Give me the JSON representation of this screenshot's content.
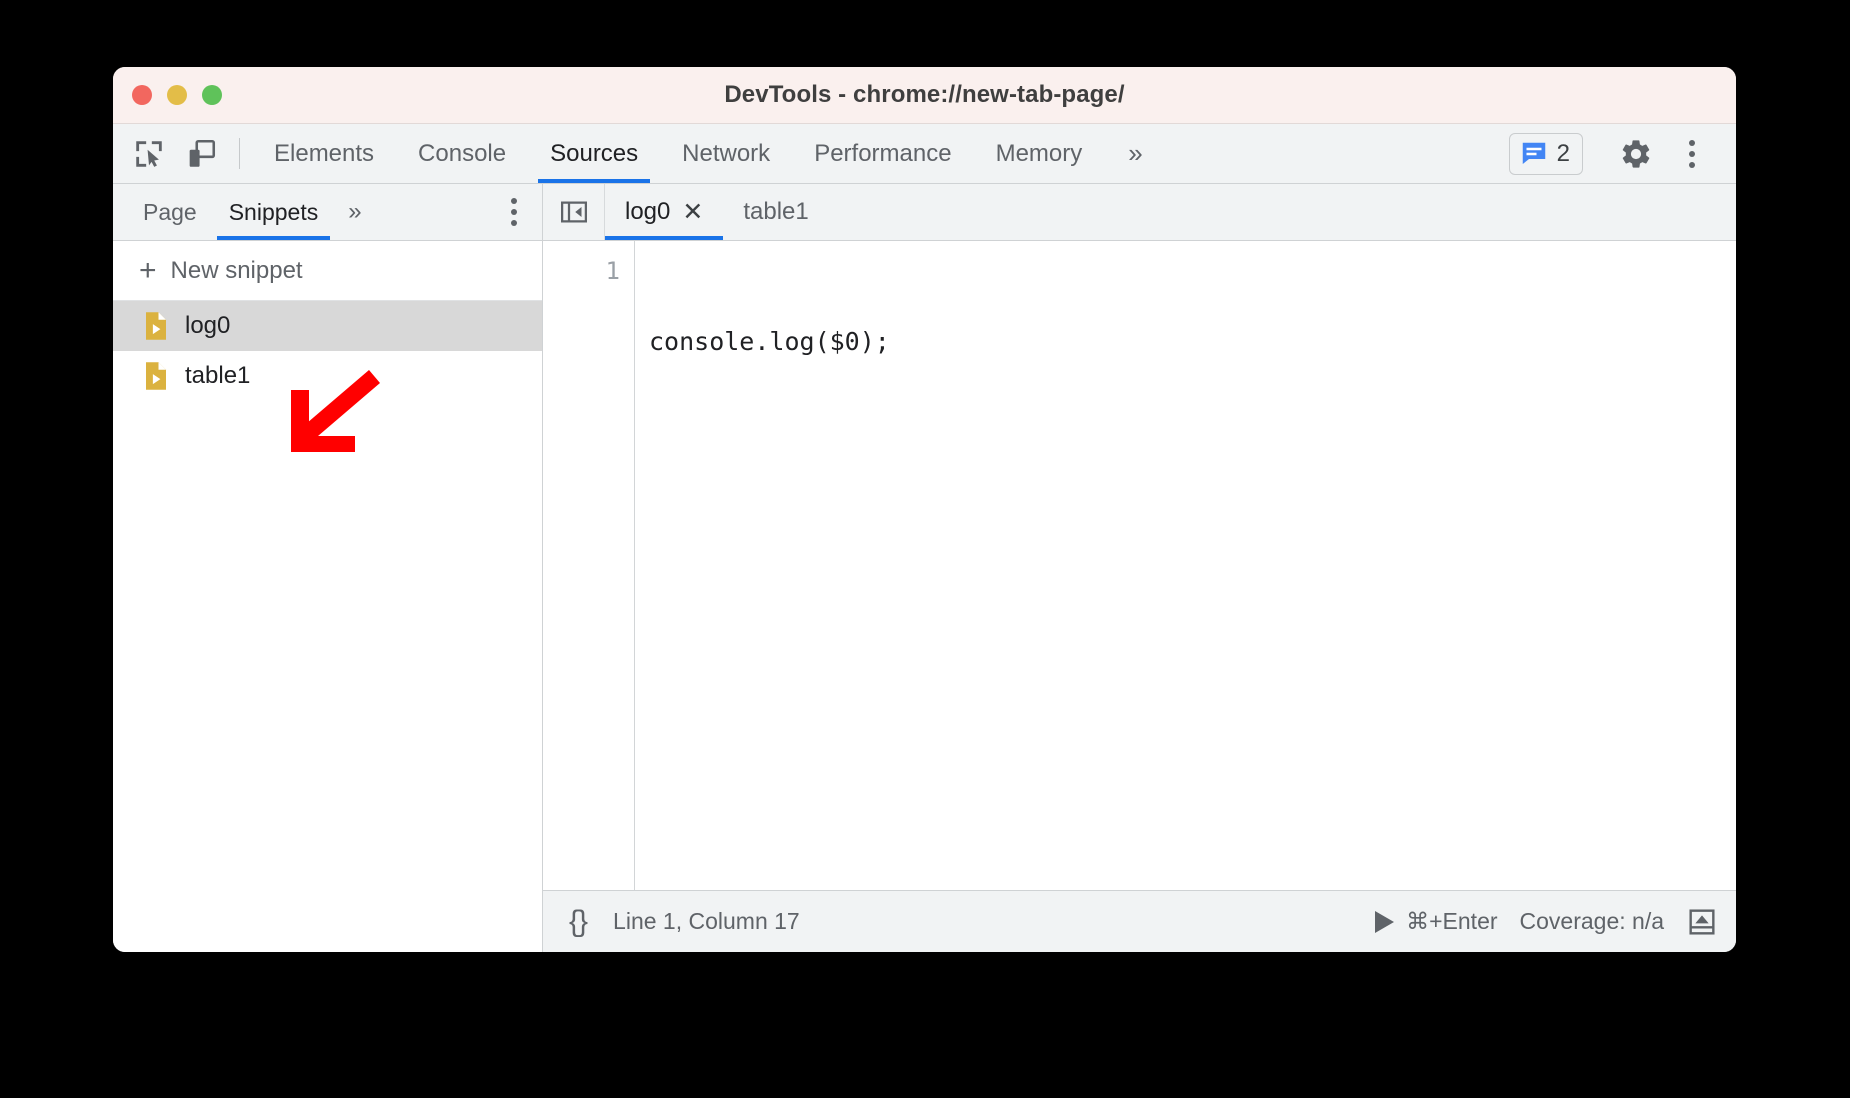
{
  "window": {
    "title": "DevTools - chrome://new-tab-page/",
    "traffic_lights": [
      "close-red",
      "minimize-yellow",
      "maximize-green"
    ]
  },
  "main_toolbar": {
    "icons": [
      {
        "name": "inspect-element-icon",
        "title": "Inspect element"
      },
      {
        "name": "device-toolbar-icon",
        "title": "Toggle device toolbar"
      }
    ],
    "tabs": [
      {
        "label": "Elements",
        "active": false
      },
      {
        "label": "Console",
        "active": false
      },
      {
        "label": "Sources",
        "active": true
      },
      {
        "label": "Network",
        "active": false
      },
      {
        "label": "Performance",
        "active": false
      },
      {
        "label": "Memory",
        "active": false
      }
    ],
    "overflow_label": "»",
    "message_badge": {
      "icon": "message-bubble-icon",
      "count": "2"
    },
    "settings_icon": "gear-icon",
    "more_options_icon": "more-vertical-icon",
    "accent_color": "#1a73e8",
    "badge_color": "#4285f4"
  },
  "navigator": {
    "tabs": [
      {
        "label": "Page",
        "active": false
      },
      {
        "label": "Snippets",
        "active": true
      }
    ],
    "overflow_label": "»",
    "more_options_icon": "more-vertical-icon",
    "new_snippet": {
      "plus": "+",
      "label": "New snippet"
    },
    "snippets": [
      {
        "label": "log0",
        "selected": true,
        "icon": "snippet-file-icon"
      },
      {
        "label": "table1",
        "selected": false,
        "icon": "snippet-file-icon"
      }
    ],
    "snippet_icon_color": "#dbb23f"
  },
  "editor": {
    "collapse_icon": "collapse-sidebar-icon",
    "tabs": [
      {
        "label": "log0",
        "active": true,
        "closable": true,
        "close_glyph": "✕"
      },
      {
        "label": "table1",
        "active": false,
        "closable": false
      }
    ],
    "lines": [
      {
        "number": "1",
        "text": "console.log($0);"
      }
    ]
  },
  "statusbar": {
    "pretty_print": "{}",
    "cursor_position": "Line 1, Column 17",
    "run_shortcut": "⌘+Enter",
    "run_icon": "play-icon",
    "coverage": "Coverage: n/a",
    "drawer_icon": "show-drawer-icon"
  },
  "annotation": {
    "arrow": {
      "color": "#ff0000",
      "direction": "down-left",
      "name": "annotation-arrow"
    }
  }
}
